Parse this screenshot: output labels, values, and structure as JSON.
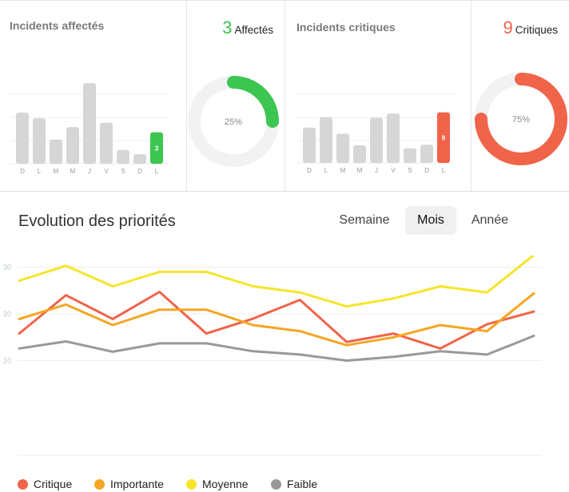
{
  "panels": {
    "affected": {
      "title": "Incidents affectés",
      "kpi_value": "3",
      "kpi_label": "Affectés",
      "percent_label": "25%",
      "percent": 25,
      "color": "#3dc551"
    },
    "critical": {
      "title": "Incidents critiques",
      "kpi_value": "9",
      "kpi_label": "Critiques",
      "percent_label": "75%",
      "percent": 75,
      "color": "#f0644a"
    }
  },
  "evolution": {
    "title": "Evolution des priorités",
    "tabs": [
      {
        "label": "Semaine",
        "active": false
      },
      {
        "label": "Mois",
        "active": true
      },
      {
        "label": "Année",
        "active": false
      }
    ]
  },
  "chart_data": [
    {
      "type": "bar",
      "categories": [
        "D",
        "L",
        "M",
        "M",
        "J",
        "V",
        "S",
        "D",
        "L"
      ],
      "values": [
        7,
        6.2,
        3.3,
        5,
        11,
        5.6,
        1.9,
        1.3,
        4.3
      ],
      "highlight_index": 8,
      "highlight_label": "3",
      "highlight_color": "#3dc551",
      "ylim": [
        0,
        12
      ]
    },
    {
      "type": "bar",
      "categories": [
        "D",
        "L",
        "M",
        "M",
        "J",
        "V",
        "S",
        "D",
        "L"
      ],
      "values": [
        5.8,
        7.5,
        4.8,
        2.9,
        7.4,
        8.1,
        2.4,
        3,
        8.3
      ],
      "highlight_index": 8,
      "highlight_label": "9",
      "highlight_color": "#f0644a",
      "ylim": [
        0,
        11
      ]
    },
    {
      "type": "line",
      "ylim": [
        0,
        40
      ],
      "yticks": [
        10,
        20,
        30,
        40
      ],
      "grid": true,
      "legend": "bottom",
      "series": [
        {
          "name": "Critique",
          "color": "#f0644a",
          "values": [
            15.8,
            24,
            18.9,
            24.7,
            15.8,
            19,
            23,
            14,
            15.8,
            12.6,
            17.8,
            20.5
          ]
        },
        {
          "name": "Importante",
          "color": "#f5a623",
          "values": [
            18.9,
            22,
            17.6,
            20.9,
            20.9,
            17.6,
            16.3,
            13.3,
            15,
            17.6,
            16.3,
            24.4
          ]
        },
        {
          "name": "Moyenne",
          "color": "#f5e52a",
          "values": [
            27.1,
            30.3,
            25.9,
            29,
            29,
            25.9,
            24.6,
            21.6,
            23.3,
            25.9,
            24.6,
            32.6
          ]
        },
        {
          "name": "Faible",
          "color": "#999999",
          "values": [
            12.6,
            14.1,
            11.9,
            13.7,
            13.7,
            12,
            11.3,
            10,
            10.8,
            12,
            11.3,
            15.3
          ]
        }
      ]
    }
  ]
}
